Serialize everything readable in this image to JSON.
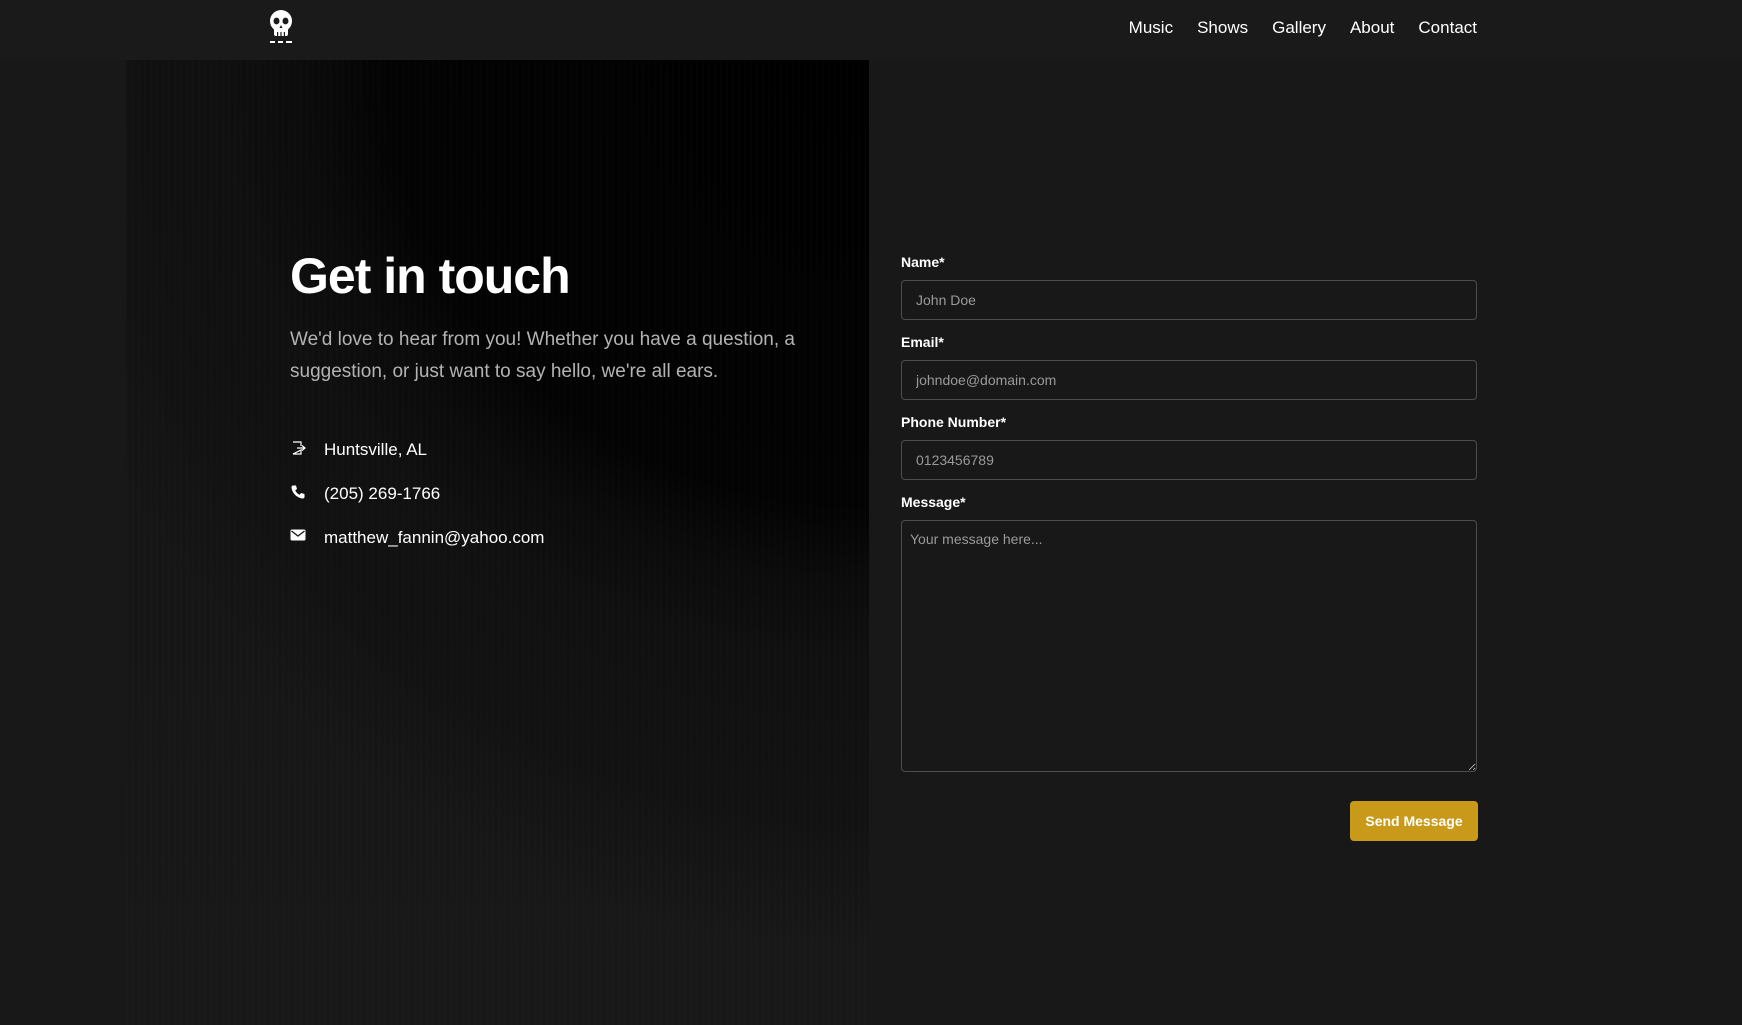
{
  "nav": {
    "logo_icon": "skull-logo-icon",
    "links": [
      "Music",
      "Shows",
      "Gallery",
      "About",
      "Contact"
    ]
  },
  "hero": {
    "title": "Get in touch",
    "intro": "We'd love to hear from you! Whether you have a question, a suggestion, or just want to say hello, we're all ears."
  },
  "contact": {
    "location": "Huntsville, AL",
    "phone": "(205) 269-1766",
    "email": "matthew_fannin@yahoo.com"
  },
  "form": {
    "name_label": "Name*",
    "name_placeholder": "John Doe",
    "email_label": "Email*",
    "email_placeholder": "johndoe@domain.com",
    "phone_label": "Phone Number*",
    "phone_placeholder": "0123456789",
    "message_label": "Message*",
    "message_placeholder": "Your message here...",
    "submit_label": "Send Message"
  },
  "colors": {
    "background": "#181818",
    "accent": "#c99a1a"
  }
}
